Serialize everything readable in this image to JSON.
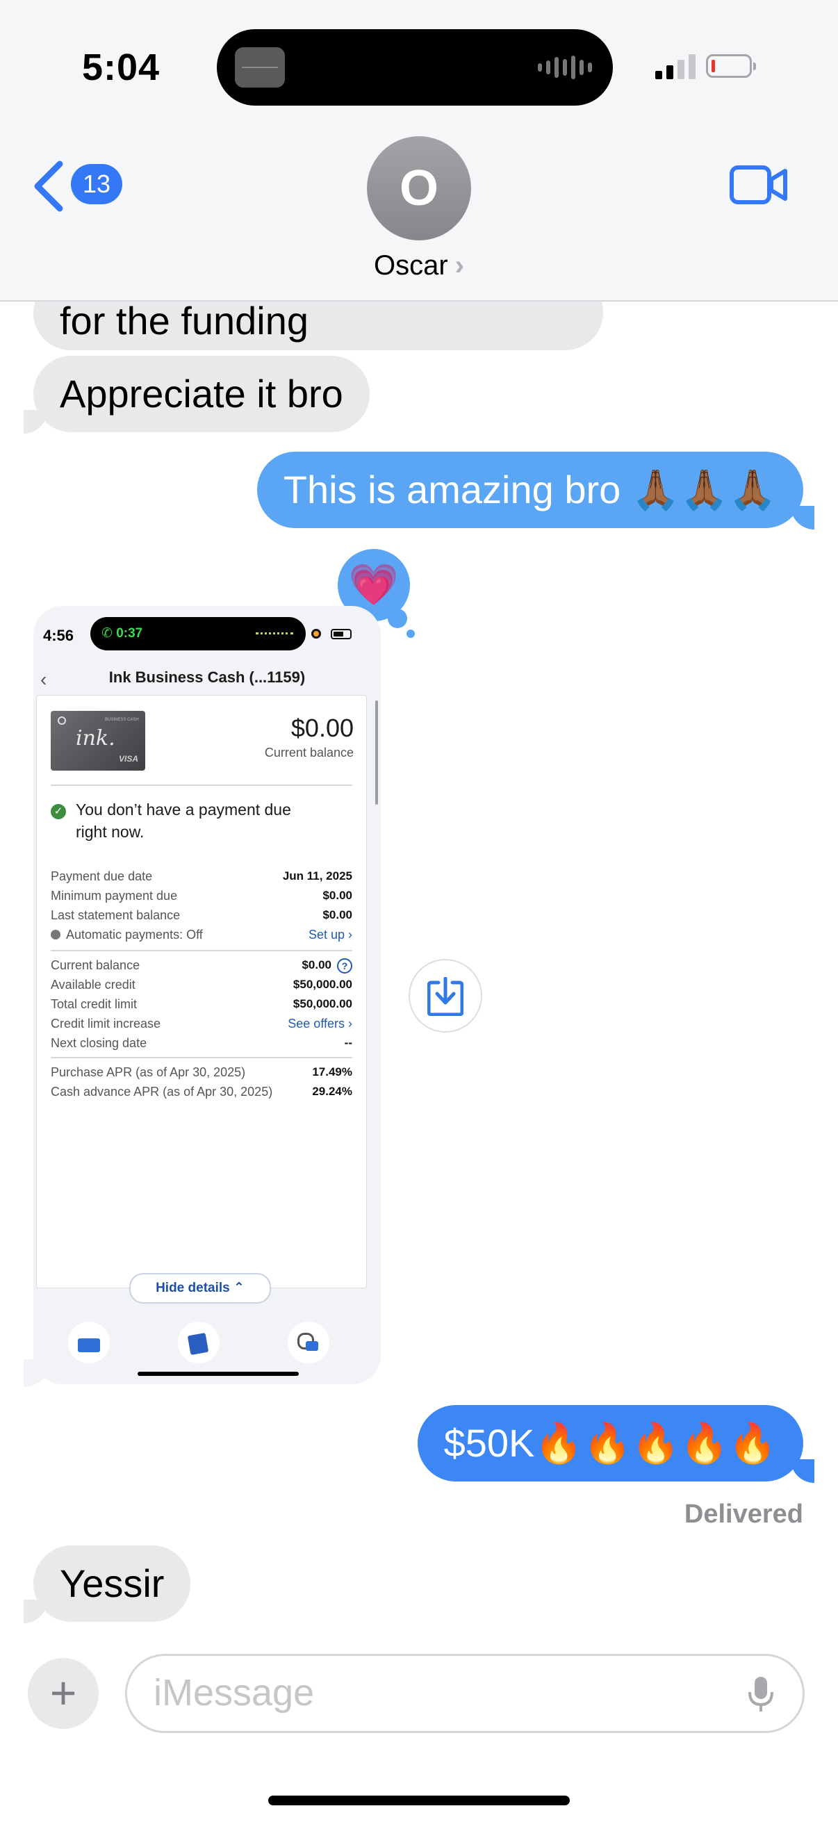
{
  "status_bar": {
    "time": "5:04"
  },
  "header": {
    "back_count": "13",
    "avatar_initial": "O",
    "contact_name": "Oscar",
    "contact_chevron": "›"
  },
  "messages": [
    {
      "dir": "in",
      "text": "for the funding"
    },
    {
      "dir": "in",
      "text": "Appreciate it bro"
    },
    {
      "dir": "out",
      "text": "This is amazing bro 🙏🏾🙏🏾🙏🏾",
      "reaction": "💗"
    },
    {
      "dir": "in",
      "type": "screenshot"
    },
    {
      "dir": "out",
      "text": "$50K🔥🔥🔥🔥🔥"
    },
    {
      "dir": "in",
      "text": "Yessir"
    }
  ],
  "delivered_label": "Delivered",
  "screenshot": {
    "time": "4:56",
    "call_timer": "0:37",
    "back": "‹",
    "title": "Ink Business Cash (...1159)",
    "card": {
      "ink": "ink.",
      "visa": "VISA",
      "brand": "BUSINESS CASH"
    },
    "balance": "$0.00",
    "balance_label": "Current balance",
    "no_payment": "You don’t have a payment due right now.",
    "rows_a": [
      {
        "label": "Payment due date",
        "value": "Jun 11, 2025"
      },
      {
        "label": "Minimum payment due",
        "value": "$0.00"
      },
      {
        "label": "Last statement balance",
        "value": "$0.00"
      }
    ],
    "autopay_label": "Automatic payments: Off",
    "autopay_link": "Set up ›",
    "rows_b": [
      {
        "label": "Current balance",
        "value": "$0.00"
      },
      {
        "label": "Available credit",
        "value": "$50,000.00"
      },
      {
        "label": "Total credit limit",
        "value": "$50,000.00"
      }
    ],
    "cli_label": "Credit limit increase",
    "cli_link": "See offers ›",
    "next_closing_label": "Next closing date",
    "next_closing_value": "--",
    "rows_c": [
      {
        "label": "Purchase APR (as of Apr 30, 2025)",
        "value": "17.49%"
      },
      {
        "label": "Cash advance APR (as of Apr 30, 2025)",
        "value": "29.24%"
      }
    ],
    "hide_details": "Hide details ⌃"
  },
  "composer": {
    "plus": "+",
    "placeholder": "iMessage"
  },
  "colors": {
    "blue_bubble": "#3d87f5",
    "light_blue_bubble": "#5aa6f4",
    "gray_bubble": "#e9e9eb",
    "ios_blue": "#3478f6"
  },
  "icons": [
    "back-chevron-icon",
    "video-call-icon",
    "signal-icon",
    "battery-icon",
    "download-icon",
    "microphone-icon",
    "plus-icon",
    "heart-icon"
  ]
}
